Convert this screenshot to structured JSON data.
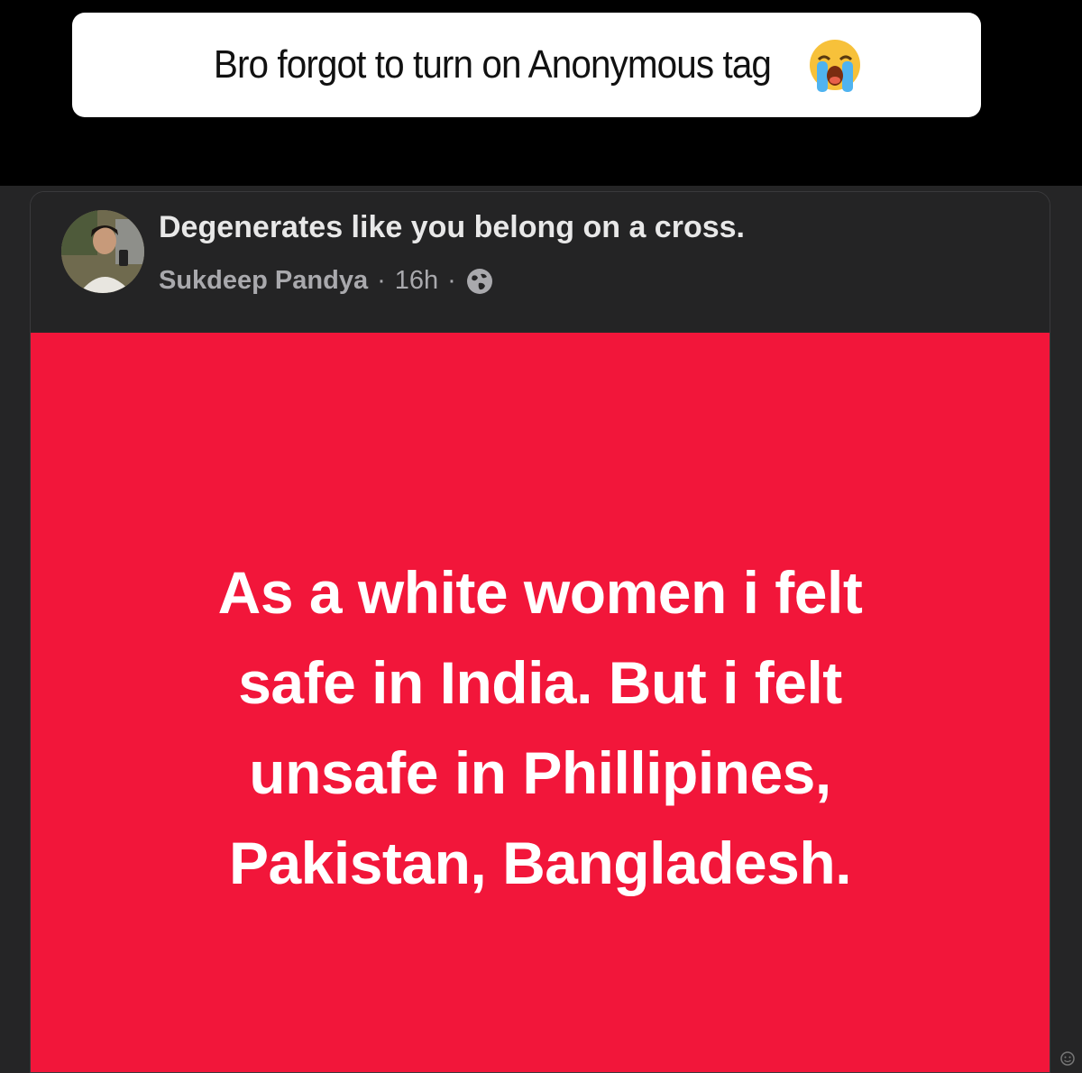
{
  "caption": {
    "text": "Bro forgot to turn on Anonymous tag",
    "emoji_icon": "loudly-crying-face-icon"
  },
  "post": {
    "comment": "Degenerates like you belong on a cross.",
    "author": "Sukdeep Pandya",
    "separator": "·",
    "time": "16h",
    "privacy_icon": "globe-icon",
    "panel_color": "#f2163a",
    "panel_lines": [
      "As a white women i felt",
      "safe in India. But i felt",
      "unsafe in Phillipines,",
      "Pakistan, Bangladesh."
    ]
  }
}
